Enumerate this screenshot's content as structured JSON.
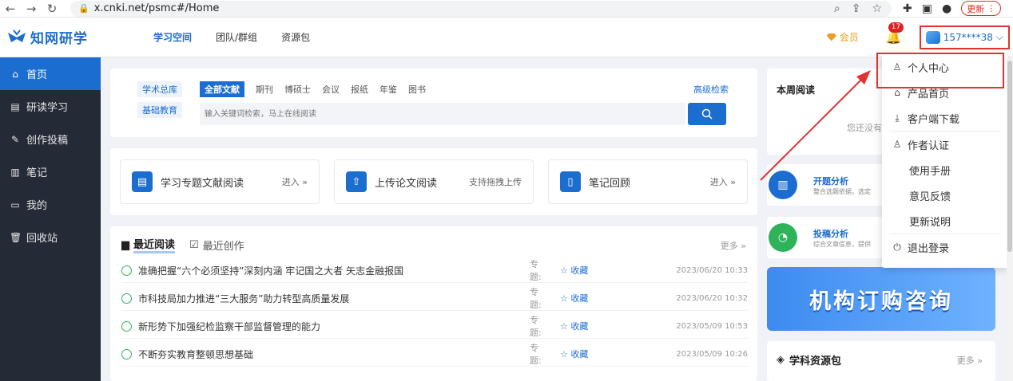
{
  "browser": {
    "url": "x.cnki.net/psmc#/Home",
    "update_label": "更新"
  },
  "header": {
    "logo_text": "知网研学",
    "nav": [
      {
        "label": "学习空间",
        "active": true
      },
      {
        "label": "团队/群组",
        "active": false
      },
      {
        "label": "资源包",
        "active": false
      }
    ],
    "vip_label": "会员",
    "notification_count": "17",
    "user_name": "157****38"
  },
  "sidebar": {
    "items": [
      {
        "label": "首页",
        "icon": "home-icon",
        "active": true
      },
      {
        "label": "研读学习",
        "icon": "book-icon",
        "active": false
      },
      {
        "label": "创作投稿",
        "icon": "edit-icon",
        "active": false
      },
      {
        "label": "笔记",
        "icon": "note-icon",
        "active": false
      },
      {
        "label": "我的",
        "icon": "user-folder-icon",
        "active": false
      },
      {
        "label": "回收站",
        "icon": "trash-icon",
        "active": false
      }
    ]
  },
  "search": {
    "library_tabs": [
      "学术总库",
      "基础教育"
    ],
    "type_tabs": [
      "全部文献",
      "期刊",
      "博硕士",
      "会议",
      "报纸",
      "年鉴",
      "图书"
    ],
    "advanced_label": "高级检索",
    "placeholder": "输入关键词检索，马上在线阅读"
  },
  "tools": [
    {
      "name": "学习专题文献阅读",
      "link": "进入 »",
      "icon": "topic-icon"
    },
    {
      "name": "上传论文阅读",
      "link": "支持拖拽上传",
      "icon": "upload-icon"
    },
    {
      "name": "笔记回顾",
      "link": "进入 »",
      "icon": "notebook-icon"
    }
  ],
  "recent": {
    "tab_active": "最近阅读",
    "tab_inactive": "最近创作",
    "more_label": "更多 »",
    "topic_label": "专题:",
    "fav_label": "☆ 收藏",
    "rows": [
      {
        "title": "准确把握“六个必须坚持”深刻内涵 牢记国之大者 矢志金融报国",
        "time": "2023/06/20 10:33"
      },
      {
        "title": "市科技局加力推进“三大服务”助力转型高质量发展",
        "time": "2023/06/20 10:32"
      },
      {
        "title": "新形势下加强纪检监察干部监督管理的能力",
        "time": "2023/05/09 10:53"
      },
      {
        "title": "不断夯实教育整顿思想基础",
        "time": "2023/05/09 10:26"
      }
    ]
  },
  "right": {
    "week_title": "本周阅读",
    "week_empty": "您还没有阅",
    "analyses": [
      {
        "name": "开题分析",
        "desc": "整合选题依据，选定",
        "color": "#1c6dd0"
      },
      {
        "name": "投稿分析",
        "desc": "综合文章信息，提供",
        "color": "#2fb35a"
      }
    ],
    "banner_text": "机构订购咨询",
    "resource_title": "学科资源包",
    "resource_more": "更多 »"
  },
  "dropdown": {
    "items": [
      {
        "label": "个人中心",
        "icon": "user-icon"
      },
      {
        "label": "产品首页",
        "icon": "home-icon"
      },
      {
        "label": "客户端下载",
        "icon": "download-icon"
      },
      {
        "label": "作者认证",
        "icon": "author-icon"
      },
      {
        "label": "使用手册",
        "icon": ""
      },
      {
        "label": "意见反馈",
        "icon": ""
      },
      {
        "label": "更新说明",
        "icon": ""
      },
      {
        "label": "退出登录",
        "icon": "power-icon"
      }
    ]
  }
}
